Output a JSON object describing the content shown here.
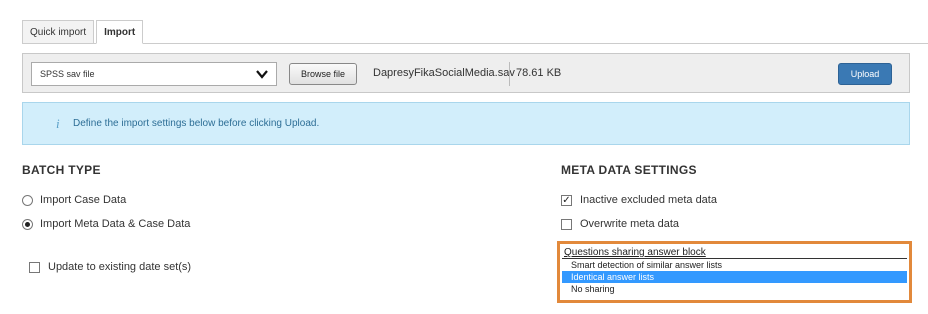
{
  "tabs": [
    {
      "label": "Quick import",
      "active": false
    },
    {
      "label": "Import",
      "active": true
    }
  ],
  "toolbar": {
    "file_type": "SPSS sav file",
    "browse_label": "Browse file",
    "filename": "DapresyFikaSocialMedia.sav",
    "filesize": "78.61 KB",
    "upload_label": "Upload"
  },
  "info": {
    "icon": "i",
    "text": "Define the import settings below before clicking Upload."
  },
  "batch": {
    "heading": "BATCH TYPE",
    "options": [
      {
        "label": "Import Case Data",
        "selected": false
      },
      {
        "label": "Import Meta Data & Case Data",
        "selected": true
      }
    ],
    "update_label": "Update to existing date set(s)"
  },
  "meta": {
    "heading": "META DATA SETTINGS",
    "inactive_label": "Inactive excluded meta data",
    "inactive_checked": true,
    "overwrite_label": "Overwrite meta data",
    "overwrite_checked": false
  },
  "sharing": {
    "label": "Questions sharing answer block",
    "options": [
      "Smart detection of similar answer lists",
      "Identical answer lists",
      "No sharing"
    ],
    "selected_index": 1
  },
  "colors": {
    "upload": "#3a79b4",
    "info_bg": "#d2eefb",
    "highlight": "#e2893b",
    "selection": "#3399ff"
  }
}
